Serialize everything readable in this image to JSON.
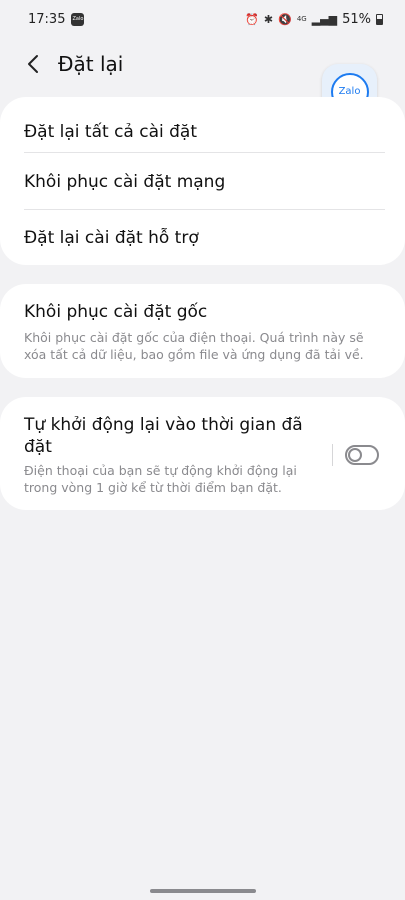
{
  "status_bar": {
    "time": "17:35",
    "app_icon_label": "Zalo",
    "network": "4G",
    "battery_percent": "51%",
    "icons": [
      "alarm-icon",
      "bluetooth-icon",
      "mute-icon",
      "signal-icon",
      "battery-icon"
    ]
  },
  "header": {
    "title": "Đặt lại",
    "back_icon": "chevron-left-icon"
  },
  "floating_app": {
    "label": "Zalo"
  },
  "group1": {
    "items": [
      {
        "label": "Đặt lại tất cả cài đặt"
      },
      {
        "label": "Khôi phục cài đặt mạng"
      },
      {
        "label": "Đặt lại cài đặt hỗ trợ"
      }
    ]
  },
  "factory_reset": {
    "title": "Khôi phục cài đặt gốc",
    "description": "Khôi phục cài đặt gốc của điện thoại. Quá trình này sẽ xóa tất cả dữ liệu, bao gồm file và ứng dụng đã tải về."
  },
  "auto_restart": {
    "title": "Tự khởi động lại vào thời gian đã đặt",
    "description": "Điện thoại của bạn sẽ tự động khởi động lại trong vòng 1 giờ kể từ thời điểm bạn đặt.",
    "enabled": false
  }
}
